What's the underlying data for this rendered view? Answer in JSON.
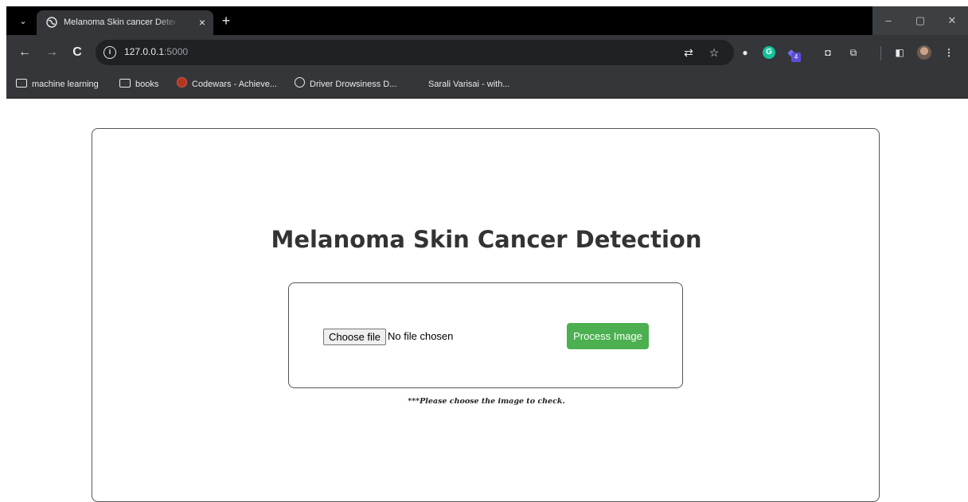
{
  "browser": {
    "tab": {
      "title": "Melanoma Skin cancer Detection",
      "close_glyph": "×"
    },
    "new_tab_glyph": "+",
    "tab_search_glyph": "⌄",
    "window_controls": {
      "minimize": "–",
      "maximize": "▢",
      "close": "✕"
    },
    "nav": {
      "back": "←",
      "forward": "→",
      "reload": "C"
    },
    "url": {
      "host": "127.0.0.1",
      "port": ":5000"
    },
    "extensions": [
      "translate-icon",
      "star-icon",
      "extension-cat-icon",
      "grammarly-icon",
      "extension-badge-icon",
      "camera-icon",
      "puzzle-icon",
      "sidepanel-icon",
      "profile-avatar",
      "menu-icon"
    ],
    "extension_badge_count": "4",
    "grammarly_letter": "G",
    "bookmarks": [
      {
        "label": "machine learning",
        "icon": "folder-icon"
      },
      {
        "label": "books",
        "icon": "folder-icon"
      },
      {
        "label": "Codewars - Achieve...",
        "icon": "codewars-icon"
      },
      {
        "label": "Driver Drowsiness D...",
        "icon": "globe-icon"
      },
      {
        "label": "Sarali Varisai - with...",
        "icon": "none"
      }
    ]
  },
  "page": {
    "title": "Melanoma Skin Cancer Detection",
    "file_input": {
      "button_label": "Choose file",
      "status": "No file chosen"
    },
    "process_button": "Process Image",
    "hint": "***Please choose the image to check."
  },
  "colors": {
    "process_button": "#4caf50",
    "chrome_dark": "#202124",
    "chrome_toolbar": "#35363a"
  }
}
